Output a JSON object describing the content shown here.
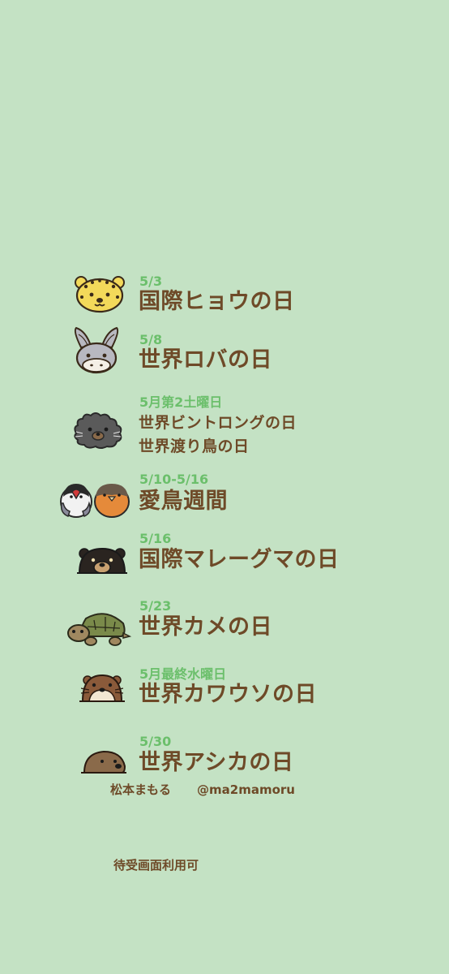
{
  "events": [
    {
      "date": "5/3",
      "titles": [
        "国際ヒョウの日"
      ],
      "icon": "leopard-icon"
    },
    {
      "date": "5/8",
      "titles": [
        "世界ロバの日"
      ],
      "icon": "donkey-icon"
    },
    {
      "date": "5月第2土曜日",
      "titles": [
        "世界ビントロングの日",
        "世界渡り鳥の日"
      ],
      "icon": "binturong-icon"
    },
    {
      "date": "5/10-5/16",
      "titles": [
        "愛鳥週間"
      ],
      "icon": "birds-icon"
    },
    {
      "date": "5/16",
      "titles": [
        "国際マレーグマの日"
      ],
      "icon": "sun-bear-icon"
    },
    {
      "date": "5/23",
      "titles": [
        "世界カメの日"
      ],
      "icon": "turtle-icon"
    },
    {
      "date": "5月最終水曜日",
      "titles": [
        "世界カワウソの日"
      ],
      "icon": "otter-icon"
    },
    {
      "date": "5/30",
      "titles": [
        "世界アシカの日"
      ],
      "icon": "sea-lion-icon"
    }
  ],
  "credit": {
    "author": "松本まもる",
    "handle": "@ma2mamoru",
    "note": "待受画面利用可"
  },
  "colors": {
    "background": "#c4e2c4",
    "date": "#6bbf6b",
    "title": "#6e4a28"
  }
}
